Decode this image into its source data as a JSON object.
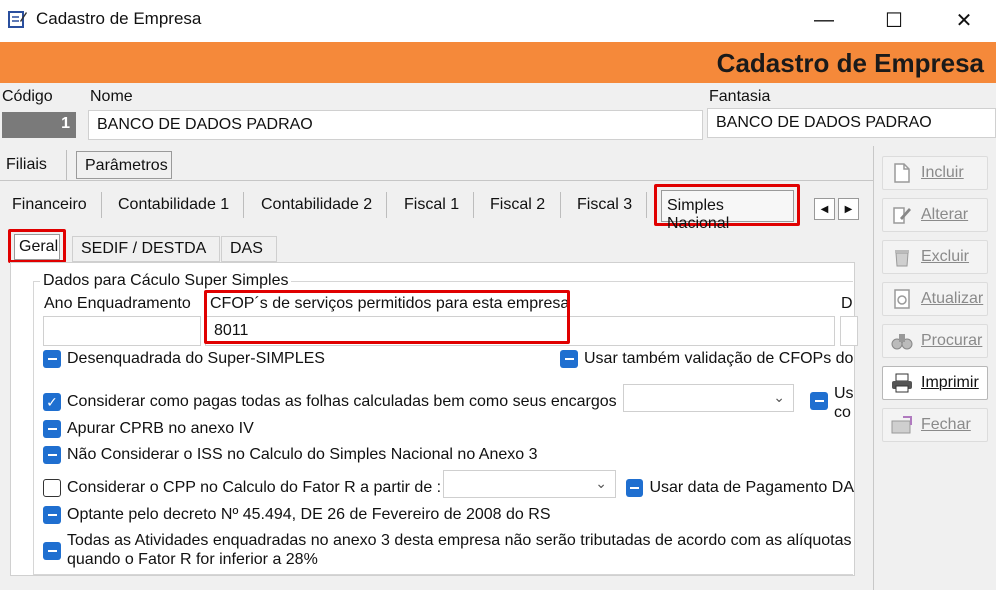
{
  "window": {
    "title": "Cadastro de Empresa",
    "minimize": "—",
    "maximize": "☐",
    "close": "✕"
  },
  "header": {
    "title": "Cadastro de Empresa"
  },
  "form": {
    "codigo_label": "Código",
    "codigo_value": "1",
    "nome_label": "Nome",
    "nome_value": "BANCO DE DADOS PADRAO",
    "fantasia_label": "Fantasia",
    "fantasia_value": "BANCO DE DADOS PADRAO"
  },
  "top_tabs": {
    "filiais": "Filiais",
    "parametros": "Parâmetros"
  },
  "param_tabs": [
    "Financeiro",
    "Contabilidade 1",
    "Contabilidade 2",
    "Fiscal 1",
    "Fiscal 2",
    "Fiscal 3",
    "Simples Nacional"
  ],
  "sub_tabs": [
    "Geral",
    "SEDIF / DESTDA",
    "DAS"
  ],
  "group": {
    "title": "Dados para Cáculo Super Simples",
    "ano_label": "Ano Enquadramento",
    "ano_value": "",
    "cfop_label": "CFOP´s de serviços permitidos para esta empresa",
    "cfop_value": "8011",
    "d_label": "D",
    "desenquadrada": "Desenquadrada do Super-SIMPLES",
    "usar_validacao": "Usar também validação de CFOPs do",
    "considerar_folhas": "Considerar como pagas todas as folhas calculadas bem como seus encargos",
    "us_label_1": "Us",
    "us_label_2": "co",
    "apurar_cprb": "Apurar CPRB no anexo IV",
    "nao_considerar_iss": "Não Considerar o ISS no Calculo do Simples Nacional no Anexo 3",
    "considerar_cpp": "Considerar o CPP no Calculo do Fator R a partir de :",
    "usar_data_pagamento": "Usar data de Pagamento DA",
    "optante_decreto": "Optante pelo decreto  Nº 45.494, DE 26 de Fevereiro de 2008 do RS",
    "todas_atividades_1": "Todas as Atividades enquadradas no anexo 3 desta empresa não serão tributadas de acordo com as alíquotas",
    "todas_atividades_2": "quando o Fator R for inferior a 28%"
  },
  "sidebar": {
    "incluir": "Incluir",
    "alterar": "Alterar",
    "excluir": "Excluir",
    "atualizar": "Atualizar",
    "procurar": "Procurar",
    "imprimir": "Imprimir",
    "fechar": "Fechar"
  },
  "colors": {
    "header_orange": "#f5893a",
    "checkbox_blue": "#1f6fd0",
    "highlight_red": "#e00000"
  }
}
